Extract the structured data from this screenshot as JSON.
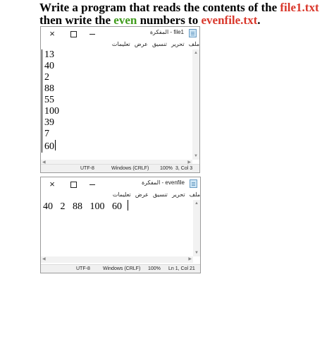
{
  "question": {
    "line1_a": "Write a program that reads the contents of the ",
    "line1_file": "file1.txt",
    "line2_a": "then write the ",
    "line2_even": "even",
    "line2_b": " numbers to ",
    "line2_file": "evenfile.txt",
    "line2_end": "."
  },
  "window1": {
    "title": "المفكرة - file1",
    "menu": [
      "ملف",
      "تحرير",
      "تنسيق",
      "عرض",
      "تعليمات"
    ],
    "lines": [
      "13",
      "40",
      "2",
      "88",
      "55",
      "100",
      "39",
      "7",
      "60"
    ],
    "status": {
      "encoding": "UTF-8",
      "line_ending": "Windows (CRLF)",
      "zoom": "100%",
      "position": "3, Col 3"
    }
  },
  "window2": {
    "title": "المفكرة - evenfile",
    "menu": [
      "ملف",
      "تحرير",
      "تنسيق",
      "عرض",
      "تعليمات"
    ],
    "content": "40   2   88   100   60",
    "status": {
      "encoding": "UTF-8",
      "line_ending": "Windows (CRLF)",
      "zoom": "100%",
      "position": "Ln 1, Col 21"
    }
  },
  "icons": {
    "close": "×",
    "scroll_up": "▲",
    "scroll_down": "▼",
    "scroll_left": "◀",
    "scroll_right": "▶"
  }
}
